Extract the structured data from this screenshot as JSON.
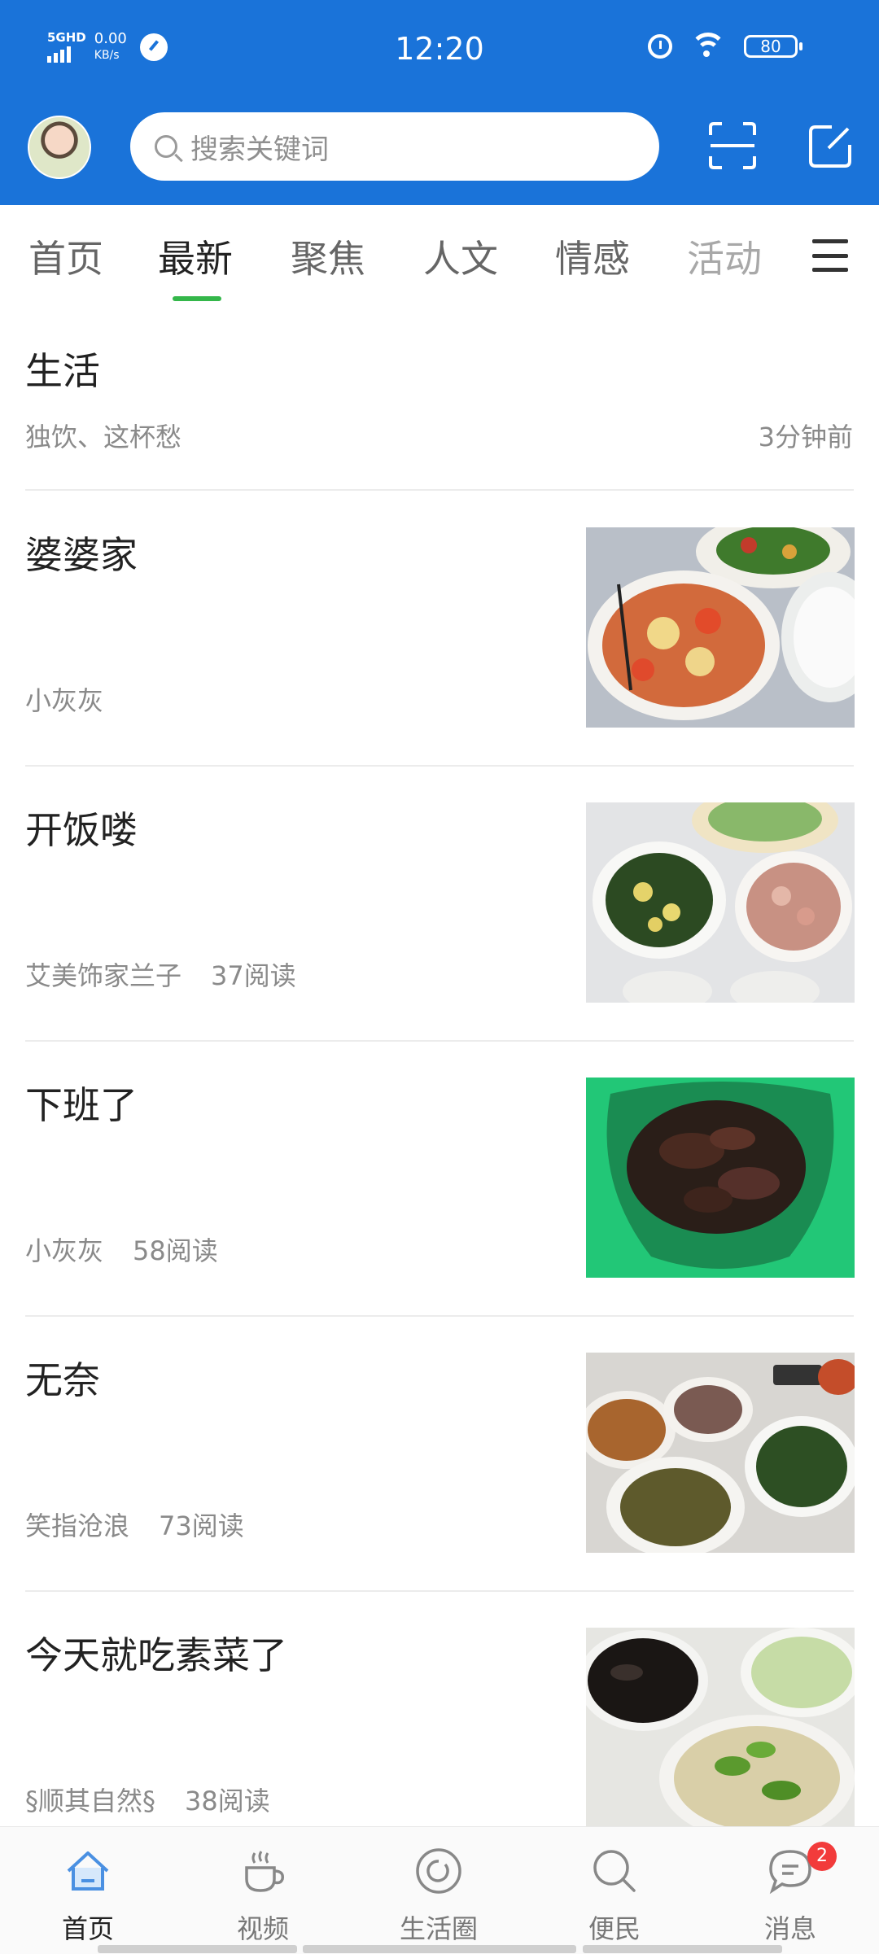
{
  "status_bar": {
    "network": "5GHD",
    "speed_value": "0.00",
    "speed_unit": "KB/s",
    "time": "12:20",
    "battery": "80"
  },
  "header": {
    "search_placeholder": "搜索关键词"
  },
  "tabs": [
    "首页",
    "最新",
    "聚焦",
    "人文",
    "情感",
    "活动"
  ],
  "active_tab": "最新",
  "first_post": {
    "title": "生活",
    "author": "独饮、这杯愁",
    "time": "3分钟前"
  },
  "articles": [
    {
      "title": "婆婆家",
      "author": "小灰灰",
      "reads": ""
    },
    {
      "title": "开饭喽",
      "author": "艾美饰家兰子",
      "reads": "37阅读"
    },
    {
      "title": "下班了",
      "author": "小灰灰",
      "reads": "58阅读"
    },
    {
      "title": "无奈",
      "author": "笑指沧浪",
      "reads": "73阅读"
    },
    {
      "title": "今天就吃素菜了",
      "author": "§顺其自然§",
      "reads": "38阅读"
    }
  ],
  "tabbar": {
    "items": [
      {
        "label": "首页",
        "icon": "home-icon"
      },
      {
        "label": "视频",
        "icon": "coffee-cup-icon"
      },
      {
        "label": "生活圈",
        "icon": "circle-icon"
      },
      {
        "label": "便民",
        "icon": "search-icon"
      },
      {
        "label": "消息",
        "icon": "chat-bubble-icon"
      }
    ],
    "message_badge": "2"
  },
  "colors": {
    "header_blue": "#1a73d9",
    "tab_indicator": "#34b74a",
    "badge_red": "#f23b3b"
  }
}
